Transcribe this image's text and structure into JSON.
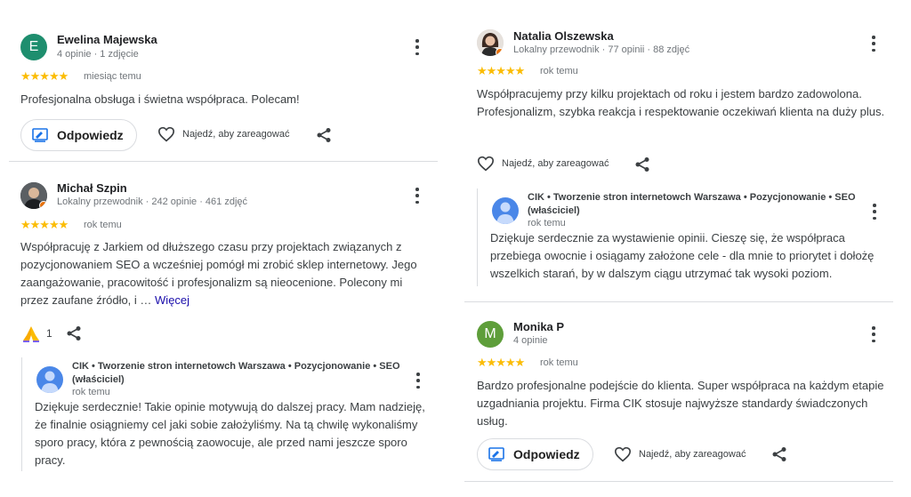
{
  "reviews_left": [
    {
      "name": "Ewelina Majewska",
      "meta": "4 opinie · 1 zdjęcie",
      "avatar_letter": "E",
      "avatar_color": "#1e8e6e",
      "rating": 5,
      "stars": "★★★★★",
      "time": "miesiąc temu",
      "text": "Profesjonalna obsługa i świetna współpraca. Polecam!",
      "reply_label": "Odpowiedz",
      "react_label": "Najedź, aby zareagować"
    },
    {
      "name": "Michał Szpin",
      "meta": "Lokalny przewodnik · 242 opinie · 461 zdjęć",
      "rating": 5,
      "stars": "★★★★★",
      "time": "rok temu",
      "text": "Współpracuję z Jarkiem od dłuższego czasu przy projektach związanych z pozycjonowaniem SEO a wcześniej pomógł mi zrobić sklep internetowy. Jego zaangażowanie, pracowitość i profesjonalizm są nieocenione. Polecony mi przez zaufane źródło, i …",
      "more_label": "Więcej",
      "reaction_count": "1",
      "owner_reply": {
        "name": "CIK • Tworzenie stron internetowch Warszawa • Pozycjonowanie • SEO (właściciel)",
        "time": "rok temu",
        "text": "Dziękuje serdecznie! Takie opinie motywują do dalszej pracy. Mam nadzieję, że finalnie osiągniemy cel jaki sobie założyliśmy. Na tą chwilę wykonaliśmy sporo pracy, która z pewnością zaowocuje, ale przed nami jeszcze sporo pracy."
      }
    }
  ],
  "reviews_right": [
    {
      "name": "Natalia Olszewska",
      "meta": "Lokalny przewodnik · 77 opinii · 88 zdjęć",
      "rating": 5,
      "stars": "★★★★★",
      "time": "rok temu",
      "text": "Współpracujemy przy kilku projektach od roku i jestem bardzo zadowolona. Profesjonalizm, szybka reakcja i respektowanie oczekiwań klienta na duży plus.",
      "react_label": "Najedź, aby zareagować",
      "owner_reply": {
        "name": "CIK • Tworzenie stron internetowch Warszawa • Pozycjonowanie • SEO (właściciel)",
        "time": "rok temu",
        "text": "Dziękuje serdecznie za wystawienie opinii. Cieszę się, że współpraca przebiega owocnie i osiągamy założone cele - dla mnie to priorytet i dołożę wszelkich starań, by w dalszym ciągu utrzymać tak wysoki poziom."
      }
    },
    {
      "name": "Monika P",
      "meta": "4 opinie",
      "avatar_letter": "M",
      "avatar_color": "#5e9e3a",
      "rating": 5,
      "stars": "★★★★★",
      "time": "rok temu",
      "text": "Bardzo profesjonalne podejście do klienta. Super współpraca na każdym etapie uzgadniania projektu. Firma CIK stosuje najwyższe standardy świadczonych usług.",
      "reply_label": "Odpowiedz",
      "react_label": "Najedź, aby zareagować"
    }
  ],
  "icons": {
    "more": "three-dots-vertical-icon",
    "reply": "reply-edit-icon",
    "react": "heart-outline-icon",
    "share": "share-icon",
    "reaction": "praying-hands-icon"
  }
}
